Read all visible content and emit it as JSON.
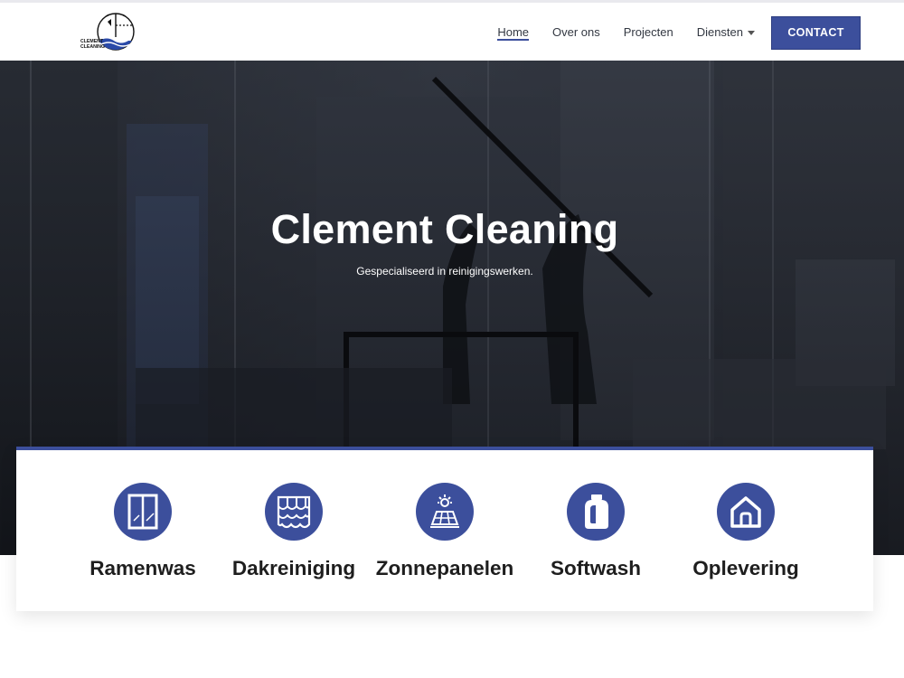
{
  "header": {
    "logo_text": "CLEMENT CLEANING",
    "nav": [
      {
        "label": "Home",
        "active": true
      },
      {
        "label": "Over ons",
        "active": false
      },
      {
        "label": "Projecten",
        "active": false
      },
      {
        "label": "Diensten",
        "active": false,
        "dropdown": true
      }
    ],
    "contact_label": "CONTACT"
  },
  "hero": {
    "title": "Clement Cleaning",
    "subtitle": "Gespecialiseerd in reinigingswerken."
  },
  "services": [
    {
      "label": "Ramenwas",
      "icon": "window-icon"
    },
    {
      "label": "Dakreiniging",
      "icon": "roof-tiles-icon"
    },
    {
      "label": "Zonnepanelen",
      "icon": "solar-panel-icon"
    },
    {
      "label": "Softwash",
      "icon": "detergent-bottle-icon"
    },
    {
      "label": "Oplevering",
      "icon": "house-icon"
    }
  ],
  "colors": {
    "accent": "#3c4f9c",
    "hero_overlay": "#1d2129",
    "text_dark": "#1e1e1e"
  }
}
